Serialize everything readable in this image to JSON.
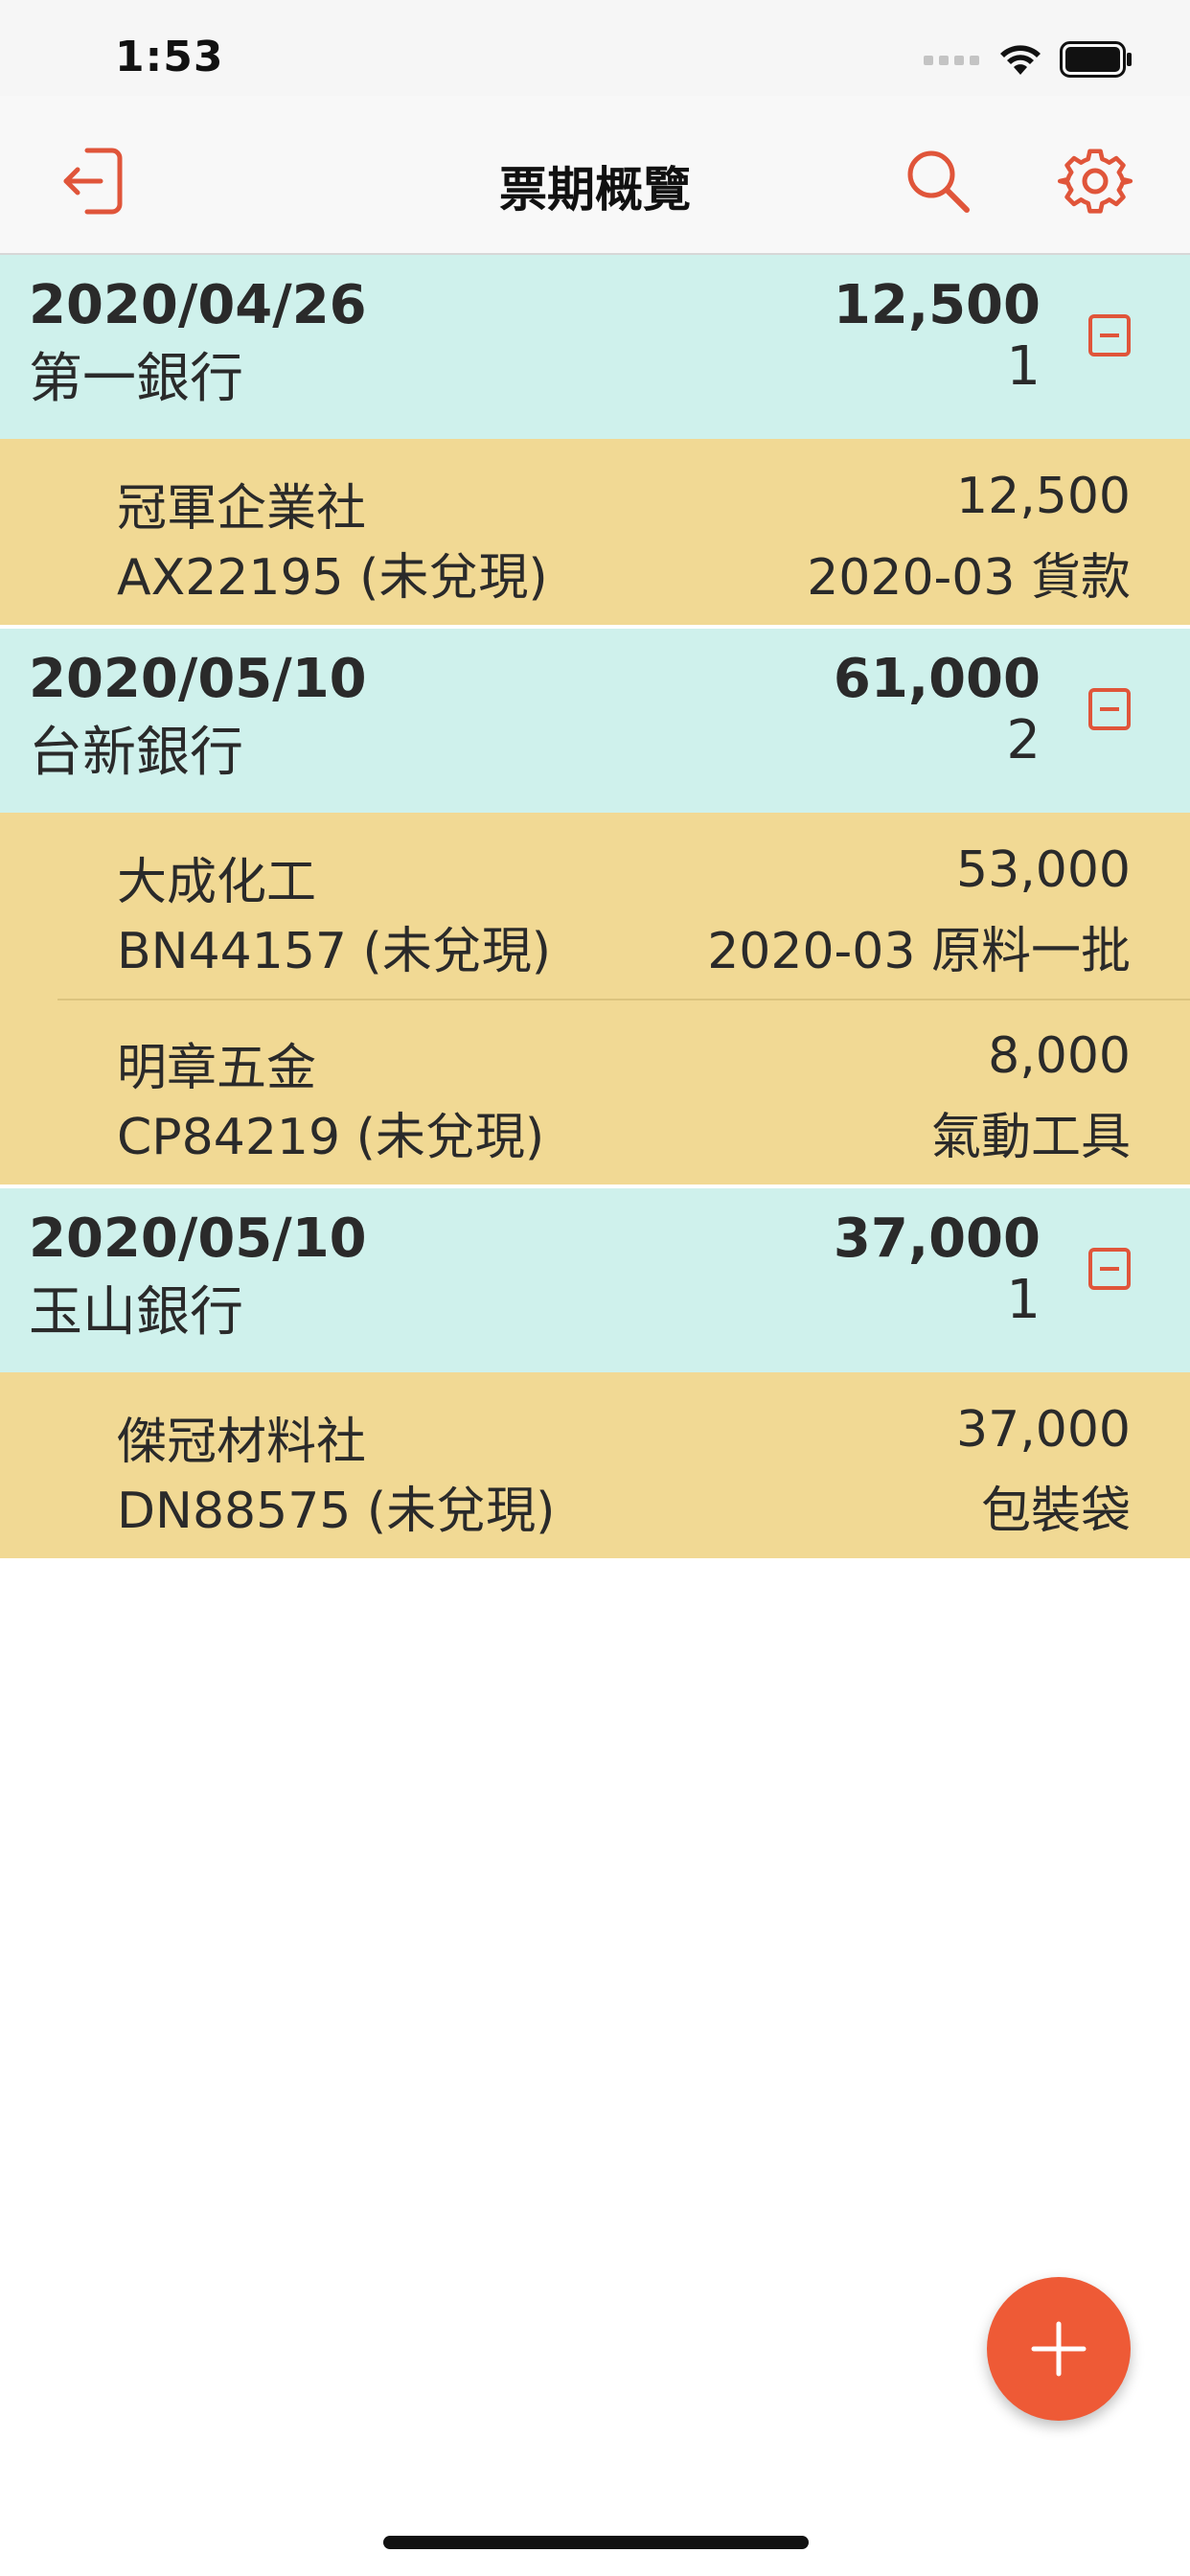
{
  "status_bar": {
    "time": "1:53"
  },
  "nav": {
    "title": "票期概覽",
    "icons": [
      "logout-icon",
      "search-icon",
      "gear-icon"
    ]
  },
  "colors": {
    "accent": "#E0553A",
    "group_header_bg": "#CFF1EC",
    "item_bg": "#F1D994",
    "fab_bg": "#EE5A36"
  },
  "groups": [
    {
      "date": "2020/04/26",
      "bank": "第一銀行",
      "total": "12,500",
      "count": "1",
      "items": [
        {
          "payee": "冠軍企業社",
          "check": "AX22195 (未兌現)",
          "amount": "12,500",
          "note": "2020-03 貨款"
        }
      ]
    },
    {
      "date": "2020/05/10",
      "bank": "台新銀行",
      "total": "61,000",
      "count": "2",
      "items": [
        {
          "payee": "大成化工",
          "check": "BN44157 (未兌現)",
          "amount": "53,000",
          "note": "2020-03 原料一批"
        },
        {
          "payee": "明章五金",
          "check": "CP84219 (未兌現)",
          "amount": "8,000",
          "note": "氣動工具"
        }
      ]
    },
    {
      "date": "2020/05/10",
      "bank": "玉山銀行",
      "total": "37,000",
      "count": "1",
      "items": [
        {
          "payee": "傑冠材料社",
          "check": "DN88575 (未兌現)",
          "amount": "37,000",
          "note": "包裝袋"
        }
      ]
    }
  ]
}
